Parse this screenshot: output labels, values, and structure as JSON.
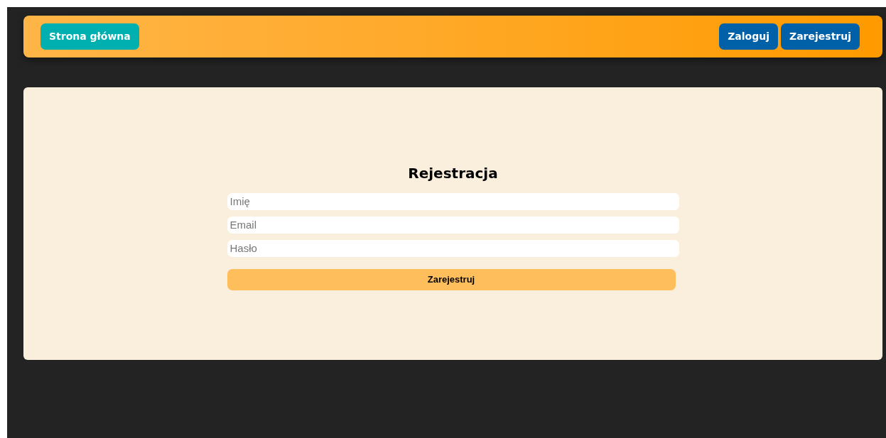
{
  "header": {
    "home_button": "Strona główna",
    "buttons": [
      {
        "label": "Zaloguj"
      },
      {
        "label": "Zarejestruj"
      }
    ]
  },
  "form": {
    "title": "Rejestracja",
    "fields": [
      {
        "placeholder": "Imię"
      },
      {
        "placeholder": "Email"
      },
      {
        "placeholder": "Hasło"
      }
    ],
    "submit": "Zarejestruj"
  }
}
